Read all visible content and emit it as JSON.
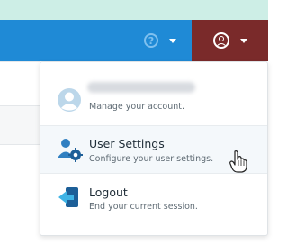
{
  "header": {
    "help_icon_text": "?",
    "colors": {
      "strip": "#cdeee6",
      "navbar": "#1f8ad6",
      "user_button": "#7a2a2a"
    }
  },
  "dropdown": {
    "account": {
      "email": "",
      "subtitle": "Manage your account."
    },
    "settings": {
      "title": "User Settings",
      "subtitle": "Configure your user settings."
    },
    "logout": {
      "title": "Logout",
      "subtitle": "End your current session."
    }
  },
  "icons": [
    "help-icon",
    "user-circle-icon",
    "avatar-icon",
    "user-settings-icon",
    "logout-icon",
    "hand-cursor-icon"
  ]
}
